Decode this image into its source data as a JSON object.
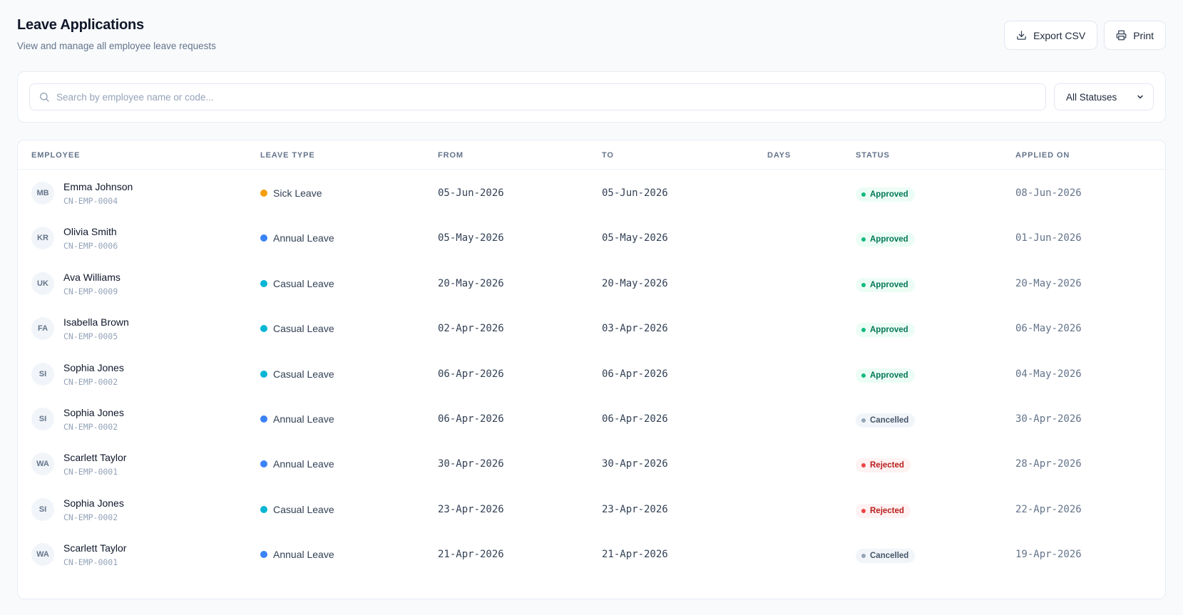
{
  "header": {
    "title": "Leave Applications",
    "subtitle": "View and manage all employee leave requests"
  },
  "actions": {
    "export_label": "Export CSV",
    "print_label": "Print"
  },
  "filters": {
    "search_placeholder": "Search by employee name or code...",
    "search_value": "",
    "status_selected": "All Statuses"
  },
  "icons": {
    "export": "download-icon",
    "print": "printer-icon",
    "search": "search-icon",
    "select": "chevron-down-icon"
  },
  "colors": {
    "sick_leave": "#f59e0b",
    "annual_leave": "#3b82f6",
    "casual_leave": "#06b6d4",
    "approved": "#10b981",
    "cancelled": "#94a3b8",
    "rejected": "#ef4444"
  },
  "table": {
    "columns": [
      "Employee",
      "Leave Type",
      "From",
      "To",
      "Days",
      "Status",
      "Applied On"
    ],
    "rows": [
      {
        "initials": "MB",
        "name": "Emma Johnson",
        "code": "CN-EMP-0004",
        "leave_type": "Sick Leave",
        "from": "05-Jun-2026",
        "to": "05-Jun-2026",
        "days": "",
        "status": "Approved",
        "applied_on": "08-Jun-2026"
      },
      {
        "initials": "KR",
        "name": "Olivia Smith",
        "code": "CN-EMP-0006",
        "leave_type": "Annual Leave",
        "from": "05-May-2026",
        "to": "05-May-2026",
        "days": "",
        "status": "Approved",
        "applied_on": "01-Jun-2026"
      },
      {
        "initials": "UK",
        "name": "Ava Williams",
        "code": "CN-EMP-0009",
        "leave_type": "Casual Leave",
        "from": "20-May-2026",
        "to": "20-May-2026",
        "days": "",
        "status": "Approved",
        "applied_on": "20-May-2026"
      },
      {
        "initials": "FA",
        "name": "Isabella Brown",
        "code": "CN-EMP-0005",
        "leave_type": "Casual Leave",
        "from": "02-Apr-2026",
        "to": "03-Apr-2026",
        "days": "",
        "status": "Approved",
        "applied_on": "06-May-2026"
      },
      {
        "initials": "SI",
        "name": "Sophia Jones",
        "code": "CN-EMP-0002",
        "leave_type": "Casual Leave",
        "from": "06-Apr-2026",
        "to": "06-Apr-2026",
        "days": "",
        "status": "Approved",
        "applied_on": "04-May-2026"
      },
      {
        "initials": "SI",
        "name": "Sophia Jones",
        "code": "CN-EMP-0002",
        "leave_type": "Annual Leave",
        "from": "06-Apr-2026",
        "to": "06-Apr-2026",
        "days": "",
        "status": "Cancelled",
        "applied_on": "30-Apr-2026"
      },
      {
        "initials": "WA",
        "name": "Scarlett Taylor",
        "code": "CN-EMP-0001",
        "leave_type": "Annual Leave",
        "from": "30-Apr-2026",
        "to": "30-Apr-2026",
        "days": "",
        "status": "Rejected",
        "applied_on": "28-Apr-2026"
      },
      {
        "initials": "SI",
        "name": "Sophia Jones",
        "code": "CN-EMP-0002",
        "leave_type": "Casual Leave",
        "from": "23-Apr-2026",
        "to": "23-Apr-2026",
        "days": "",
        "status": "Rejected",
        "applied_on": "22-Apr-2026"
      },
      {
        "initials": "WA",
        "name": "Scarlett Taylor",
        "code": "CN-EMP-0001",
        "leave_type": "Annual Leave",
        "from": "21-Apr-2026",
        "to": "21-Apr-2026",
        "days": "",
        "status": "Cancelled",
        "applied_on": "19-Apr-2026"
      }
    ]
  }
}
